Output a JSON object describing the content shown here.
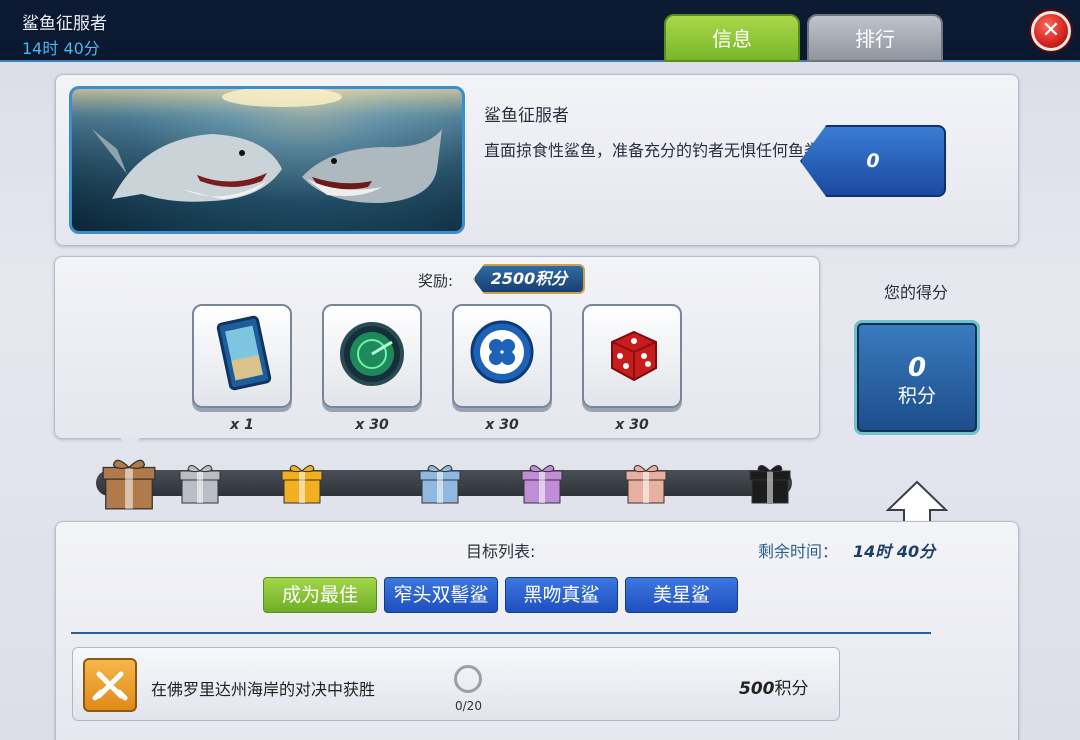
{
  "header": {
    "title": "鲨鱼征服者",
    "timer": "14时 40分"
  },
  "tabs": [
    {
      "label": "信息",
      "active": true
    },
    {
      "label": "排行",
      "active": false
    }
  ],
  "close": {
    "icon": "close-icon",
    "glyph": "✕"
  },
  "event": {
    "title": "鲨鱼征服者",
    "description": "直面掠食性鲨鱼，准备充分的钓者无惧任何鱼类！",
    "banner_icon": "shark-banner-image"
  },
  "reward": {
    "label": "奖励:",
    "points": "2500积分",
    "items": [
      {
        "icon": "photo-card-icon",
        "qty": "x 1"
      },
      {
        "icon": "sonar-radar-icon",
        "qty": "x 30"
      },
      {
        "icon": "clover-chip-icon",
        "qty": "x 30"
      },
      {
        "icon": "red-dice-icon",
        "qty": "x 30"
      }
    ]
  },
  "score": {
    "label": "您的得分",
    "value": "0",
    "unit": "积分"
  },
  "tiers": [
    {
      "name": "bronze",
      "color": "#b07a4a"
    },
    {
      "name": "silver",
      "color": "#b9bdc6"
    },
    {
      "name": "gold",
      "color": "#f0b020"
    },
    {
      "name": "sky",
      "color": "#8fb9e0"
    },
    {
      "name": "purple",
      "color": "#c08ed6"
    },
    {
      "name": "rose",
      "color": "#e8b0a0"
    },
    {
      "name": "black",
      "color": "#1c1c1c"
    }
  ],
  "goals": {
    "label": "目标列表:",
    "remaining_label": "剩余时间：",
    "remaining_value": "14时 40分",
    "chips": [
      {
        "label": "成为最佳",
        "style": "green"
      },
      {
        "label": "窄头双髻鲨",
        "style": "blue"
      },
      {
        "label": "黑吻真鲨",
        "style": "blue"
      },
      {
        "label": "美星鲨",
        "style": "blue"
      }
    ],
    "tasks": [
      {
        "text": "在佛罗里达州海岸的对决中获胜",
        "progress": "0/20",
        "reward_value": "500",
        "reward_unit": "积分",
        "score": "0",
        "icon": "crossed-swords-icon"
      }
    ]
  },
  "colors": {
    "accent_green": "#79b52a",
    "accent_blue": "#1e4fbf",
    "header_bg": "#0c1b33"
  }
}
